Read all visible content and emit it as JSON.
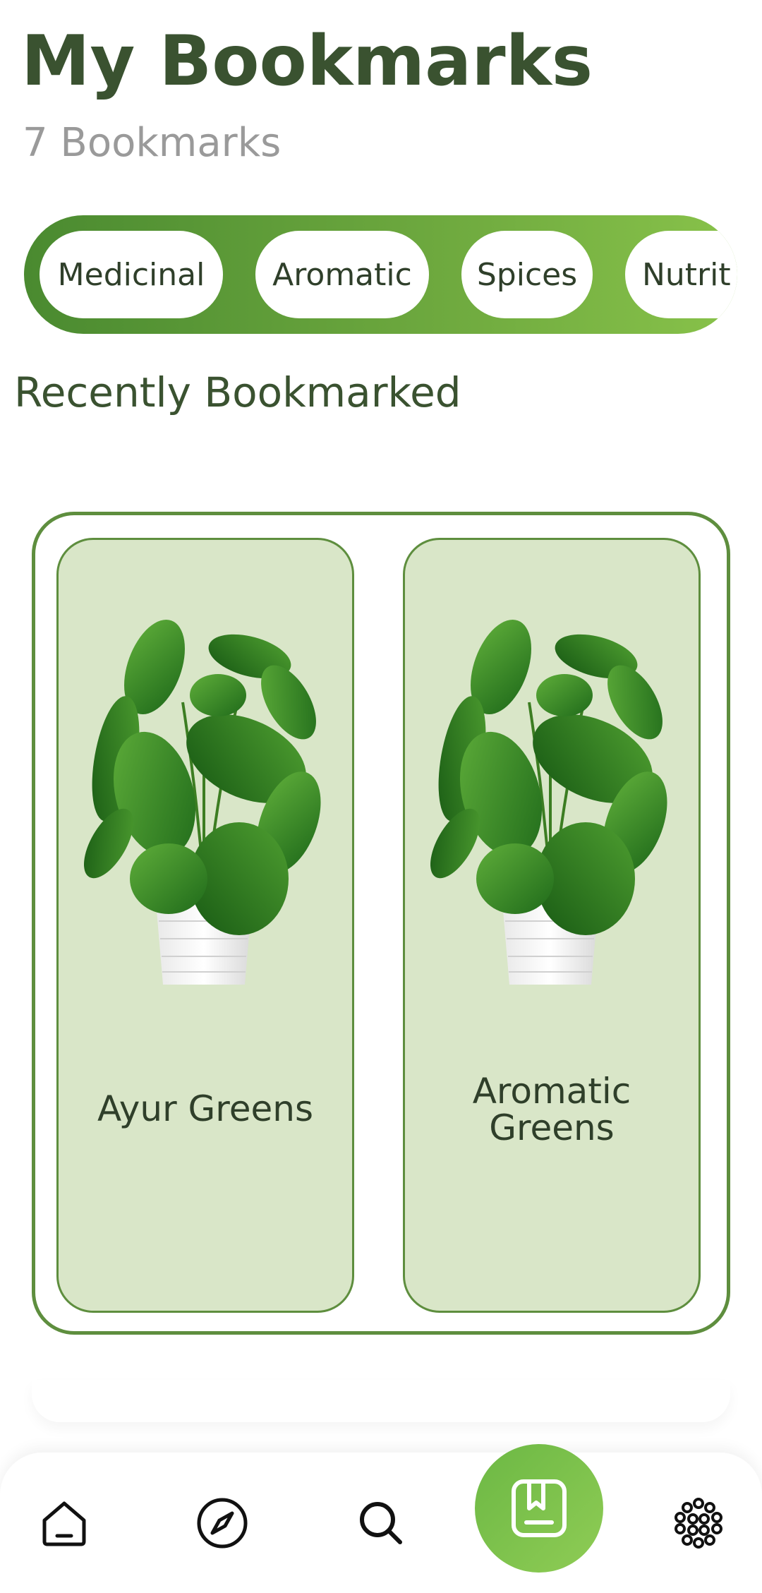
{
  "header": {
    "title": "My Bookmarks",
    "count_text": "7 Bookmarks"
  },
  "categories": [
    {
      "label": "Medicinal"
    },
    {
      "label": "Aromatic"
    },
    {
      "label": "Spices"
    },
    {
      "label": "Nutrit"
    }
  ],
  "section": {
    "title": "Recently Bookmarked"
  },
  "cards": [
    {
      "name": "Ayur Greens",
      "image": "potted-plant"
    },
    {
      "name": "Aromatic Greens",
      "image": "potted-plant"
    }
  ],
  "bottom_nav": [
    {
      "icon": "home-icon",
      "active": false
    },
    {
      "icon": "compass-icon",
      "active": false
    },
    {
      "icon": "search-icon",
      "active": false
    },
    {
      "icon": "bookmark-icon",
      "active": true
    },
    {
      "icon": "molecule-icon",
      "active": false
    }
  ],
  "colors": {
    "title": "#3a5230",
    "count": "#9a9a9a",
    "accent": "#5e8e3e",
    "card_bg": "#d9e6c8",
    "active_nav": "#7bbf4c"
  }
}
